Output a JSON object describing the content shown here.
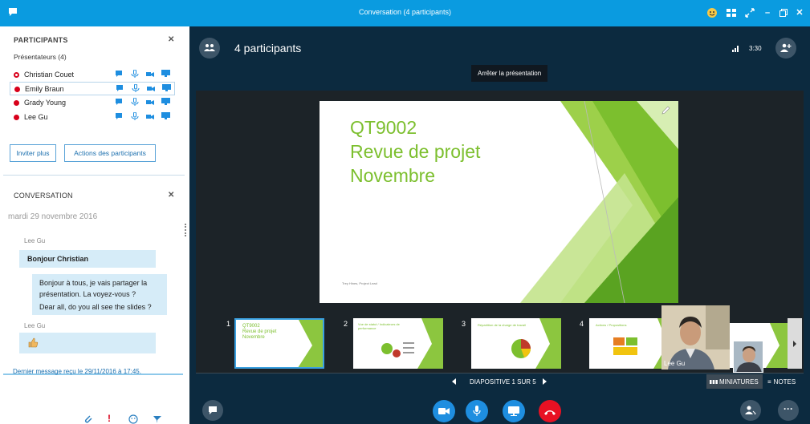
{
  "window": {
    "title": "Conversation (4 participants)"
  },
  "participants_panel": {
    "heading": "PARTICIPANTS",
    "group_label": "Présentateurs (4)",
    "people": [
      {
        "name": "Christian Couet",
        "selected": false,
        "presence": "ring"
      },
      {
        "name": "Emily Braun",
        "selected": true,
        "presence": "busy"
      },
      {
        "name": "Grady Young",
        "selected": false,
        "presence": "busy"
      },
      {
        "name": "Lee Gu",
        "selected": false,
        "presence": "busy"
      }
    ],
    "invite_label": "Inviter plus",
    "actions_label": "Actions des participants"
  },
  "conversation_panel": {
    "heading": "CONVERSATION",
    "date": "mardi 29 novembre 2016",
    "messages": [
      {
        "sender": "Lee Gu",
        "text": "Bonjour Christian"
      },
      {
        "text1": "Bonjour à tous, je vais partager la",
        "text2": "présentation. La voyez-vous ?",
        "text3": "Dear all, do you all see the slides ?"
      },
      {
        "sender": "Lee Gu",
        "text": "👍"
      }
    ],
    "last_message": "Dernier message reçu le 29/11/2016 à 17:45."
  },
  "main": {
    "participants_count": "4 participants",
    "time": "3:30",
    "stop_presenting_tooltip": "Arrêter la présentation",
    "slide": {
      "line1": "QT9002",
      "line2": "Revue de projet",
      "line3": "Novembre",
      "footer": "Trey Hines, Project Lead"
    },
    "thumbnails": [
      {
        "num": "1",
        "t1": "QT9002",
        "t2": "Revue de projet",
        "t3": "Novembre"
      },
      {
        "num": "2",
        "t1": "Vue de statut / Indicateurs de",
        "t2": "performance"
      },
      {
        "num": "3",
        "t1": "Répartition de la charge de travail"
      },
      {
        "num": "4",
        "t1": "Actions / Propositions"
      }
    ],
    "video_name": "Lee Gu",
    "slide_counter": "DIAPOSITIVE 1 SUR 5",
    "miniatures_label": "MINIATURES",
    "notes_label": "NOTES"
  },
  "colors": {
    "accent": "#0a9be0",
    "slide_green": "#7cbf2e",
    "hangup": "#e81123"
  }
}
